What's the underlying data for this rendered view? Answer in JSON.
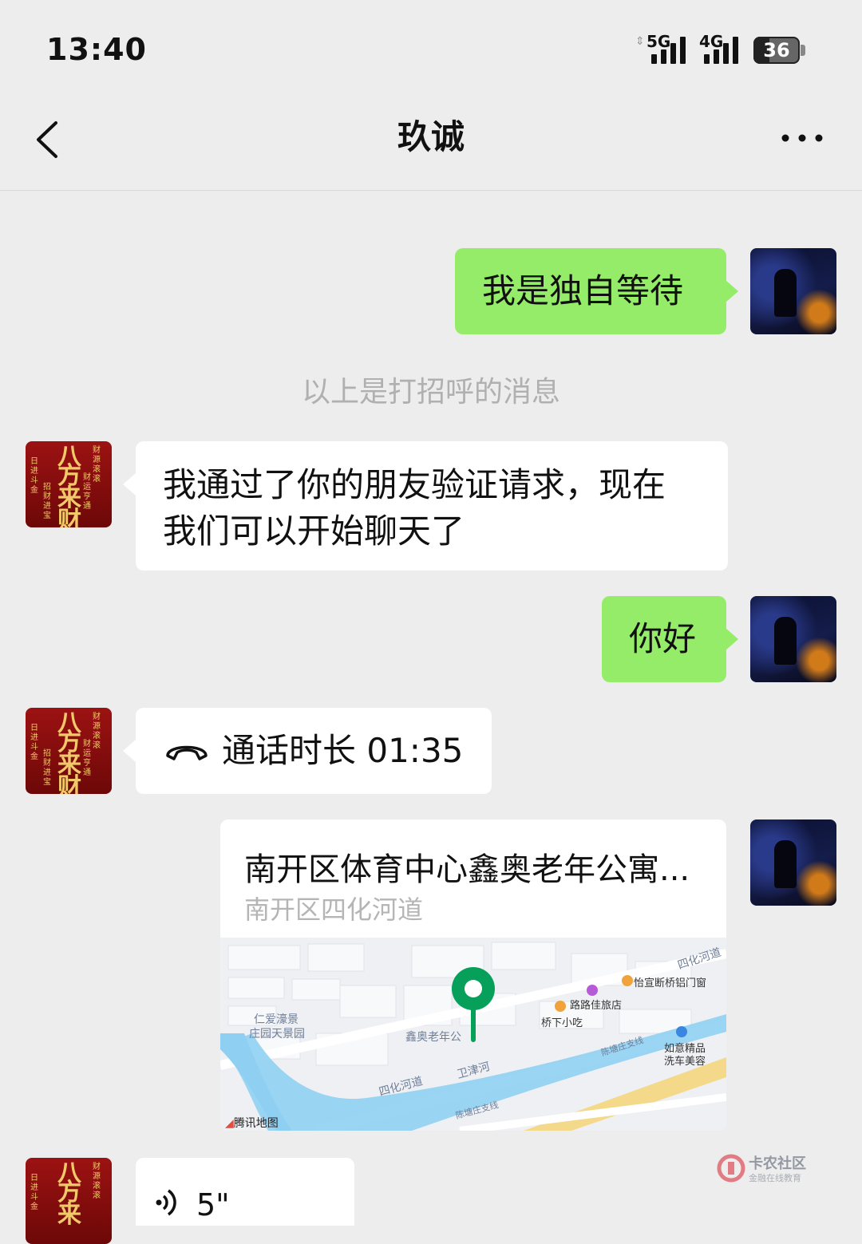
{
  "status_bar": {
    "time": "13:40",
    "network_1": "5G",
    "network_2": "4G",
    "battery": "36"
  },
  "header": {
    "title": "玖诚",
    "back_icon": "chevron-left-icon",
    "more_icon": "ellipsis-icon"
  },
  "messages": {
    "m1": {
      "sender": "me",
      "text": "我是独自等待"
    },
    "notice": "以上是打招呼的消息",
    "m2": {
      "sender": "them",
      "text_line1": "我通过了你的朋友验证请求，现在",
      "text_line2": "我们可以开始聊天了"
    },
    "m3": {
      "sender": "me",
      "text": "你好"
    },
    "m4": {
      "sender": "them",
      "icon": "phone-hangup-icon",
      "text": "通话时长 01:35"
    },
    "m5": {
      "sender": "me",
      "type": "location",
      "title": "南开区体育中心鑫奥老年公寓...",
      "subtitle": "南开区四化河道",
      "map": {
        "provider": "腾讯地图",
        "labels": [
          "仁爱濠景",
          "庄园天景园",
          "鑫奥老年公",
          "四化河道",
          "卫津河",
          "桥下小吃",
          "路路佳旅店",
          "怡宣断桥铝门窗",
          "如意精品",
          "洗车美容",
          "四化河道",
          "陈塘庄支线",
          "陈塘庄支线"
        ]
      }
    },
    "m6": {
      "sender": "them",
      "icon": "voice-icon",
      "text": "5\""
    }
  },
  "avatar_them_text": [
    "八",
    "方",
    "来",
    "财",
    "日进斗金",
    "招财进宝",
    "财源滚滚",
    "财运亨通"
  ],
  "watermark": {
    "title": "卡农社区",
    "subtitle": "金融在线教育"
  },
  "colors": {
    "background": "#ededed",
    "my_bubble": "#95ec69",
    "their_bubble": "#ffffff",
    "pin": "#07a05a"
  }
}
